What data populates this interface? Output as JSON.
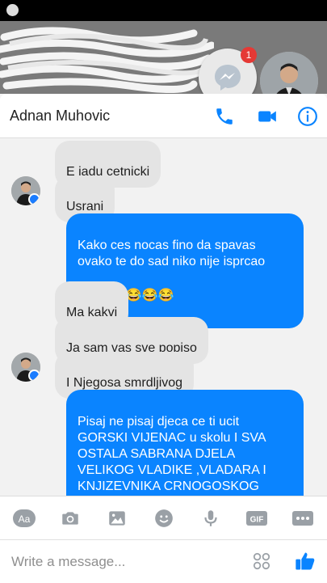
{
  "notification": {
    "badge_count": "1"
  },
  "header": {
    "contact_name": "Adnan Muhovic"
  },
  "messages": [
    {
      "dir": "in",
      "text": "E jadu cetnicki"
    },
    {
      "dir": "in",
      "text": "Usrani"
    },
    {
      "dir": "out",
      "text": "Kako ces nocas fino da spavas\novako te do sad niko nije isprcao",
      "emoji": "😂😂😂😂😂😂"
    },
    {
      "dir": "in",
      "text": "Ma kakvi"
    },
    {
      "dir": "in",
      "text": "Ja sam vas sve popiso"
    },
    {
      "dir": "in",
      "text": "I Njegosa smrdljivog"
    },
    {
      "dir": "out",
      "text": "Pisaj ne pisaj djeca ce ti ucit\nGORSKI VIJENAC u skolu I SVA\nOSTALA SABRANA DJELA\nVELIKOG VLADIKE ,VLADARA I\nKNJIZEVNIKA CRNOGOSKOG\nNJEGOSA"
    }
  ],
  "toolbar": {
    "aa_label": "Aa",
    "gif_label": "GIF"
  },
  "composer": {
    "placeholder": "Write a message..."
  },
  "colors": {
    "messenger_blue": "#0a84ff",
    "badge_red": "#e53935"
  }
}
